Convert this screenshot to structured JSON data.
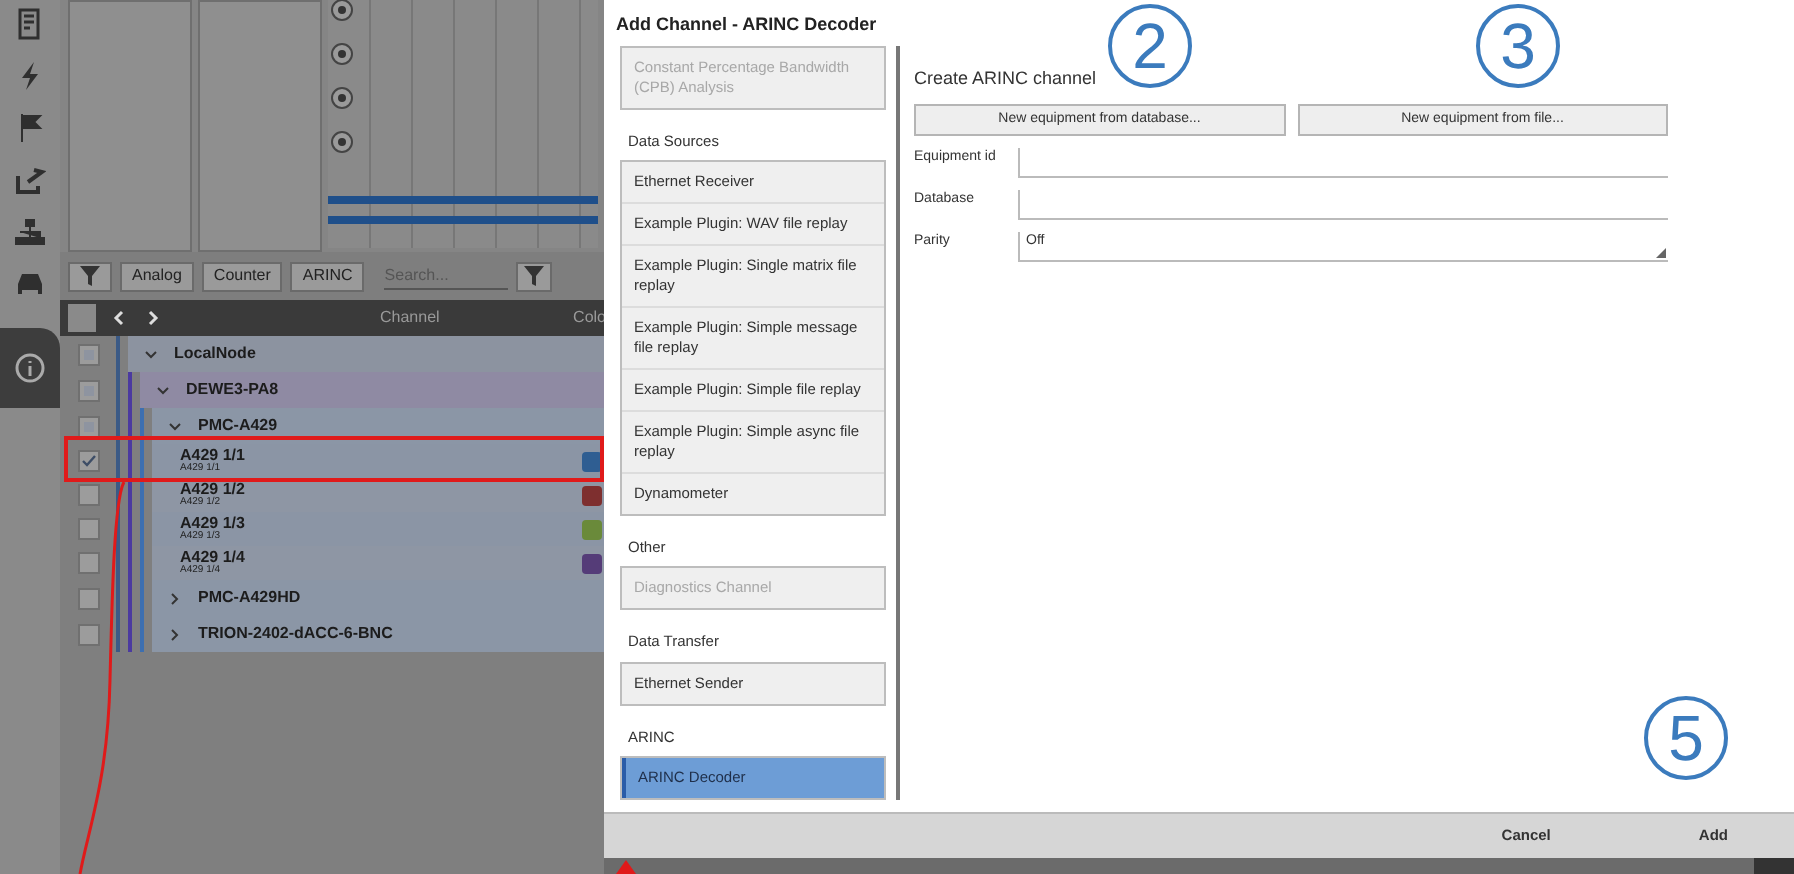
{
  "background_app": {
    "filter_buttons": [
      "Analog",
      "Counter",
      "ARINC"
    ],
    "search": {
      "placeholder": "Search..."
    },
    "table": {
      "columns": [
        "Channel",
        "Colo"
      ]
    },
    "tree": [
      {
        "name": "LocalNode",
        "checked": false,
        "partial": true,
        "expanded": true,
        "children": [
          {
            "name": "DEWE3-PA8",
            "checked": false,
            "partial": true,
            "expanded": true,
            "children": [
              {
                "name": "PMC-A429",
                "checked": false,
                "partial": true,
                "expanded": true,
                "children": [
                  {
                    "name": "A429 1/1",
                    "subtitle": "A429 1/1",
                    "checked": true,
                    "color": "#2f5e92"
                  },
                  {
                    "name": "A429 1/2",
                    "subtitle": "A429 1/2",
                    "checked": false,
                    "color": "#7e2f2f"
                  },
                  {
                    "name": "A429 1/3",
                    "subtitle": "A429 1/3",
                    "checked": false,
                    "color": "#6a8a3a"
                  },
                  {
                    "name": "A429 1/4",
                    "subtitle": "A429 1/4",
                    "checked": false,
                    "color": "#553c78"
                  }
                ]
              },
              {
                "name": "PMC-A429HD",
                "checked": false,
                "partial": false,
                "expanded": false
              },
              {
                "name": "TRION-2402-dACC-6-BNC",
                "checked": false,
                "partial": false,
                "expanded": false
              }
            ]
          }
        ]
      }
    ]
  },
  "dialog": {
    "title": "Add Channel - ARINC Decoder",
    "groups": [
      {
        "items": [
          {
            "label": "Constant Percentage Bandwidth (CPB) Analysis",
            "disabled": true,
            "selected": false
          }
        ]
      },
      {
        "heading": "Data Sources",
        "items": [
          {
            "label": "Ethernet Receiver",
            "disabled": false,
            "selected": false
          },
          {
            "label": "Example Plugin: WAV file replay",
            "disabled": false,
            "selected": false
          },
          {
            "label": "Example Plugin: Single matrix file replay",
            "disabled": false,
            "selected": false
          },
          {
            "label": "Example Plugin: Simple message file replay",
            "disabled": false,
            "selected": false
          },
          {
            "label": "Example Plugin: Simple file replay",
            "disabled": false,
            "selected": false
          },
          {
            "label": "Example Plugin: Simple async file replay",
            "disabled": false,
            "selected": false
          },
          {
            "label": "Dynamometer",
            "disabled": false,
            "selected": false
          }
        ]
      },
      {
        "heading": "Other",
        "items": [
          {
            "label": "Diagnostics Channel",
            "disabled": true,
            "selected": false
          }
        ]
      },
      {
        "heading": "Data Transfer",
        "items": [
          {
            "label": "Ethernet Sender",
            "disabled": false,
            "selected": false
          }
        ]
      },
      {
        "heading": "ARINC",
        "items": [
          {
            "label": "ARINC Decoder",
            "disabled": false,
            "selected": true
          }
        ]
      }
    ],
    "form": {
      "title": "Create ARINC channel",
      "buttons": [
        "New equipment from database...",
        "New equipment from file..."
      ],
      "fields": [
        {
          "label": "Equipment id",
          "kind": "text"
        },
        {
          "label": "Database",
          "kind": "text"
        },
        {
          "label": "Parity",
          "kind": "dropdown",
          "value": "Off"
        }
      ]
    },
    "footer_buttons": [
      "Cancel",
      "Add"
    ]
  },
  "callouts": [
    "2",
    "3",
    "5"
  ]
}
